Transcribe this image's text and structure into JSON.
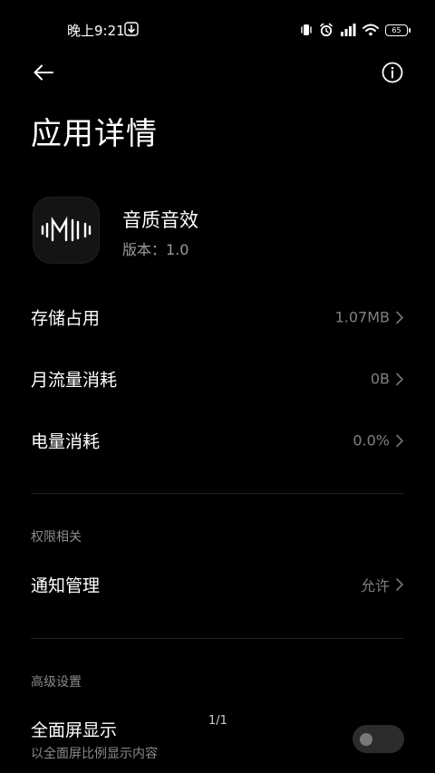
{
  "status_bar": {
    "time": "晚上9:21",
    "battery_level": "65",
    "icons": [
      "download-icon",
      "vibrate-icon",
      "alarm-icon",
      "signal-icon",
      "wifi-icon",
      "battery-icon"
    ]
  },
  "header": {
    "back_icon": "back-arrow-icon",
    "info_icon": "info-icon",
    "title": "应用详情"
  },
  "app": {
    "name": "音质音效",
    "version": "版本：1.0",
    "icon": "sound-wave-logo-icon"
  },
  "rows": [
    {
      "label": "存储占用",
      "value": "1.07MB"
    },
    {
      "label": "月流量消耗",
      "value": "0B"
    },
    {
      "label": "电量消耗",
      "value": "0.0%"
    }
  ],
  "permissions": {
    "header": "权限相关",
    "notification_label": "通知管理",
    "notification_value": "允许"
  },
  "advanced": {
    "header": "高级设置",
    "fullscreen_label": "全面屏显示",
    "fullscreen_desc": "以全面屏比例显示内容",
    "fullscreen_enabled": false
  },
  "page_counter": "1/1",
  "colors": {
    "background": "#000000",
    "primary_text": "#ffffff",
    "secondary_text": "#808080",
    "divider": "#1f1f1f",
    "toggle_off": "#2c2c2c"
  }
}
